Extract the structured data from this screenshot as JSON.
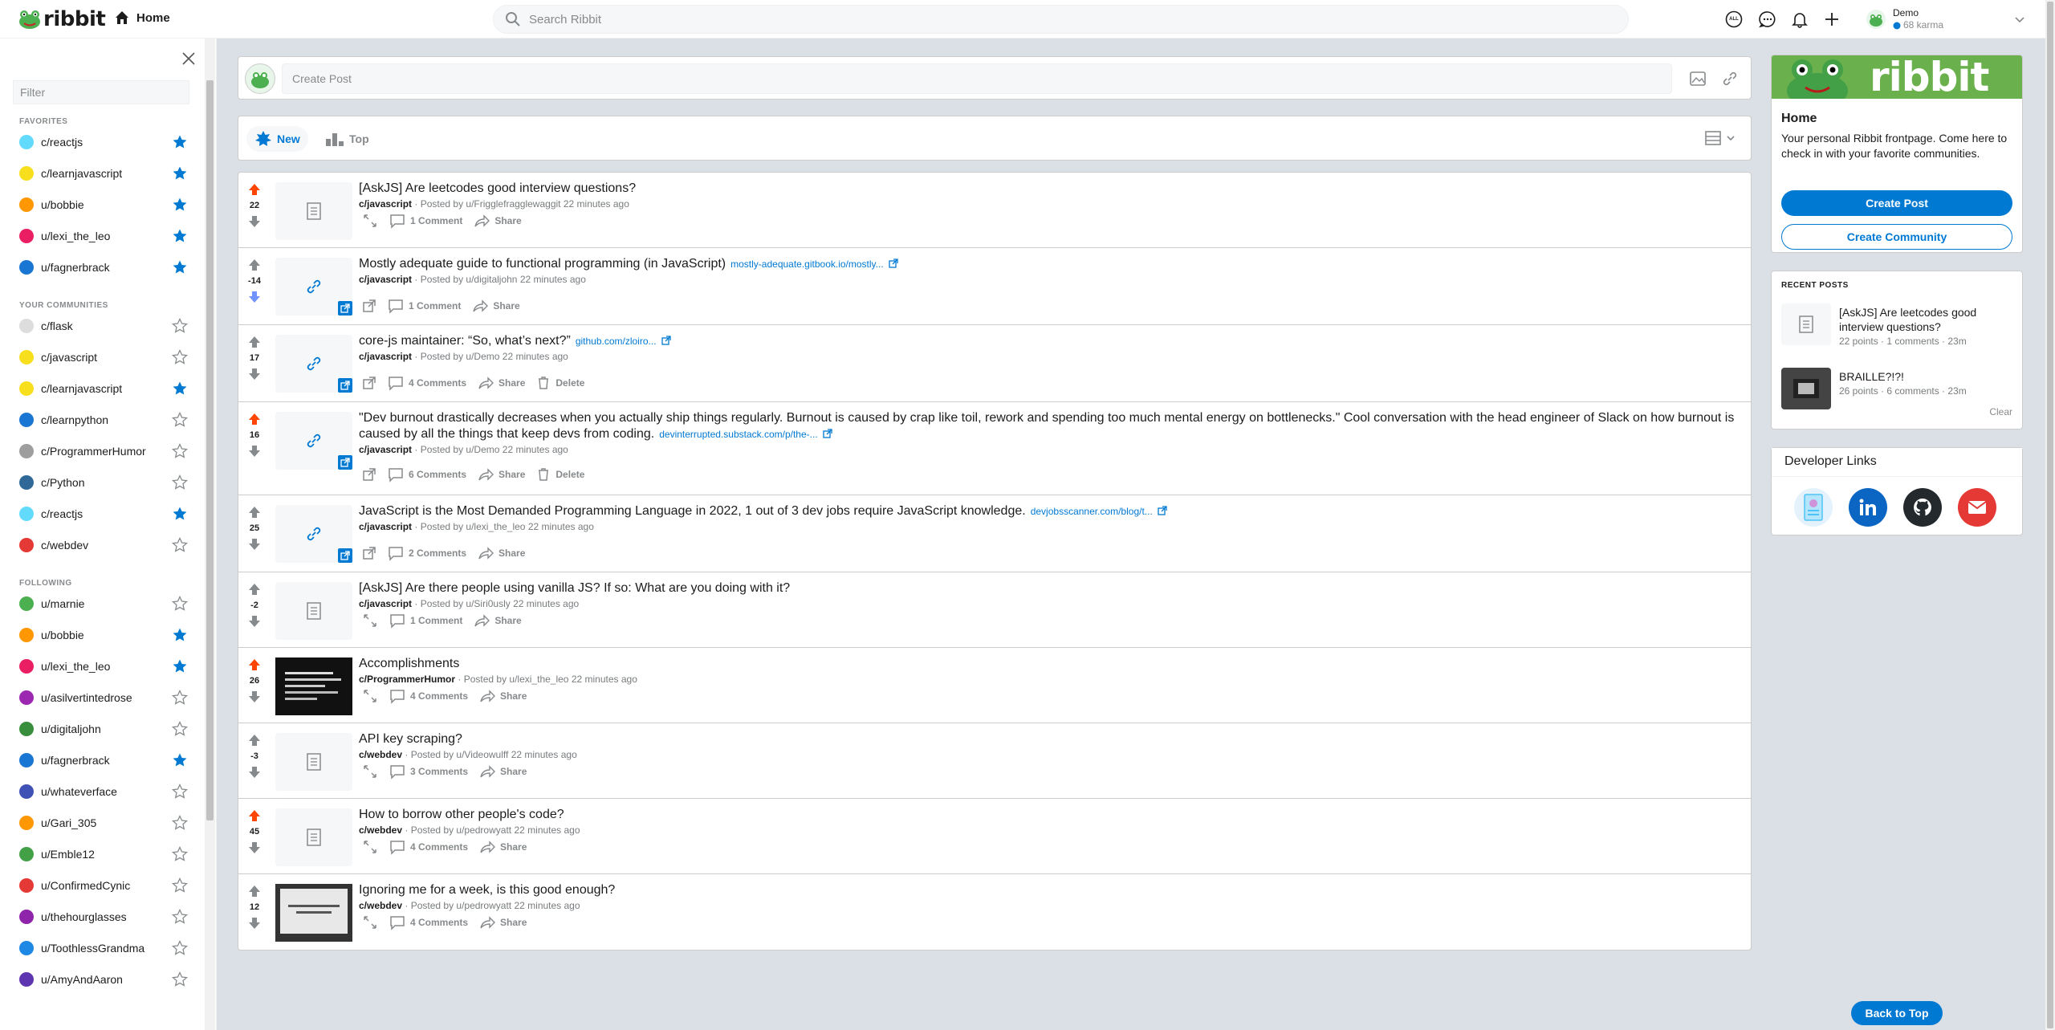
{
  "nav": {
    "logo_text": "ribbit",
    "home_label": "Home",
    "search_placeholder": "Search Ribbit",
    "user_name": "Demo",
    "user_karma": "68 karma",
    "all_badge": "ALL"
  },
  "sidebar": {
    "filter_placeholder": "Filter",
    "sections": [
      {
        "title": "Favorites",
        "items": [
          {
            "label": "c/reactjs",
            "fav": true,
            "color": "#61dafb"
          },
          {
            "label": "c/learnjavascript",
            "fav": true,
            "color": "#f7df1e"
          },
          {
            "label": "u/bobbie",
            "fav": true,
            "color": "#ff9800"
          },
          {
            "label": "u/lexi_the_leo",
            "fav": true,
            "color": "#e91e63"
          },
          {
            "label": "u/fagnerbrack",
            "fav": true,
            "color": "#1976d2"
          }
        ]
      },
      {
        "title": "Your Communities",
        "items": [
          {
            "label": "c/flask",
            "fav": false,
            "color": "#dddddd"
          },
          {
            "label": "c/javascript",
            "fav": false,
            "color": "#f7df1e"
          },
          {
            "label": "c/learnjavascript",
            "fav": true,
            "color": "#f7df1e"
          },
          {
            "label": "c/learnpython",
            "fav": false,
            "color": "#1976d2"
          },
          {
            "label": "c/ProgrammerHumor",
            "fav": false,
            "color": "#9e9e9e"
          },
          {
            "label": "c/Python",
            "fav": false,
            "color": "#306998"
          },
          {
            "label": "c/reactjs",
            "fav": true,
            "color": "#61dafb"
          },
          {
            "label": "c/webdev",
            "fav": false,
            "color": "#e53935"
          }
        ]
      },
      {
        "title": "Following",
        "items": [
          {
            "label": "u/marnie",
            "fav": false,
            "color": "#4caf50"
          },
          {
            "label": "u/bobbie",
            "fav": true,
            "color": "#ff9800"
          },
          {
            "label": "u/lexi_the_leo",
            "fav": true,
            "color": "#e91e63"
          },
          {
            "label": "u/asilvertintedrose",
            "fav": false,
            "color": "#9c27b0"
          },
          {
            "label": "u/digitaljohn",
            "fav": false,
            "color": "#388e3c"
          },
          {
            "label": "u/fagnerbrack",
            "fav": true,
            "color": "#1976d2"
          },
          {
            "label": "u/whateverface",
            "fav": false,
            "color": "#3f51b5"
          },
          {
            "label": "u/Gari_305",
            "fav": false,
            "color": "#ff9800"
          },
          {
            "label": "u/Emble12",
            "fav": false,
            "color": "#43a047"
          },
          {
            "label": "u/ConfirmedCynic",
            "fav": false,
            "color": "#e53935"
          },
          {
            "label": "u/thehourglasses",
            "fav": false,
            "color": "#8e24aa"
          },
          {
            "label": "u/ToothlessGrandma",
            "fav": false,
            "color": "#1e88e5"
          },
          {
            "label": "u/AmyAndAaron",
            "fav": false,
            "color": "#5e35b1"
          }
        ]
      }
    ]
  },
  "create_post": {
    "placeholder": "Create Post"
  },
  "sort": {
    "new_label": "New",
    "top_label": "Top"
  },
  "posts": [
    {
      "title": "[AskJS] Are leetcodes good interview questions?",
      "domain": "",
      "community": "c/javascript",
      "posted_by": "Posted by u/Frigglefragglewaggit",
      "time": "22 minutes ago",
      "score": "22",
      "vote": "up",
      "thumb": "text",
      "comments": "1 Comment",
      "share": "Share",
      "delete": "",
      "height": 94
    },
    {
      "title": "Mostly adequate guide to functional programming (in JavaScript)",
      "domain": "mostly-adequate.gitbook.io/mostly...",
      "community": "c/javascript",
      "posted_by": "Posted by u/digitaljohn",
      "time": "22 minutes ago",
      "score": "-14",
      "vote": "down",
      "thumb": "link",
      "comments": "1 Comment",
      "share": "Share",
      "delete": "",
      "height": 96
    },
    {
      "title": "core-js maintainer: “So, what’s next?”",
      "domain": "github.com/zloiro...",
      "community": "c/javascript",
      "posted_by": "Posted by u/Demo",
      "time": "22 minutes ago",
      "score": "17",
      "vote": "none",
      "thumb": "link",
      "comments": "4 Comments",
      "share": "Share",
      "delete": "Delete",
      "height": 96
    },
    {
      "title": "\"Dev burnout drastically decreases when you actually ship things regularly. Burnout is caused by crap like toil, rework and spending too much mental energy on bottlenecks.\" Cool conversation with the head engineer of Slack on how burnout is caused by all the things that keep devs from coding.",
      "domain": "devinterrupted.substack.com/p/the-...",
      "community": "c/javascript",
      "posted_by": "Posted by u/Demo",
      "time": "22 minutes ago",
      "score": "16",
      "vote": "up",
      "thumb": "link",
      "comments": "6 Comments",
      "share": "Share",
      "delete": "Delete",
      "height": 116
    },
    {
      "title": "JavaScript is the Most Demanded Programming Language in 2022, 1 out of 3 dev jobs require JavaScript knowledge.",
      "domain": "devjobsscanner.com/blog/t...",
      "community": "c/javascript",
      "posted_by": "Posted by u/lexi_the_leo",
      "time": "22 minutes ago",
      "score": "25",
      "vote": "none",
      "thumb": "link",
      "comments": "2 Comments",
      "share": "Share",
      "delete": "",
      "height": 96
    },
    {
      "title": "[AskJS] Are there people using vanilla JS? If so: What are you doing with it?",
      "domain": "",
      "community": "c/javascript",
      "posted_by": "Posted by u/Siri0usly",
      "time": "22 minutes ago",
      "score": "-2",
      "vote": "none",
      "thumb": "text",
      "comments": "1 Comment",
      "share": "Share",
      "delete": "",
      "height": 94
    },
    {
      "title": "Accomplishments",
      "domain": "",
      "community": "c/ProgrammerHumor",
      "posted_by": "Posted by u/lexi_the_leo",
      "time": "22 minutes ago",
      "score": "26",
      "vote": "up",
      "thumb": "image-dark",
      "comments": "4 Comments",
      "share": "Share",
      "delete": "",
      "height": 94
    },
    {
      "title": "API key scraping?",
      "domain": "",
      "community": "c/webdev",
      "posted_by": "Posted by u/Videowulff",
      "time": "22 minutes ago",
      "score": "-3",
      "vote": "none",
      "thumb": "text",
      "comments": "3 Comments",
      "share": "Share",
      "delete": "",
      "height": 94
    },
    {
      "title": "How to borrow other people's code?",
      "domain": "",
      "community": "c/webdev",
      "posted_by": "Posted by u/pedrowyatt",
      "time": "22 minutes ago",
      "score": "45",
      "vote": "up",
      "thumb": "text",
      "comments": "4 Comments",
      "share": "Share",
      "delete": "",
      "height": 94
    },
    {
      "title": "Ignoring me for a week, is this good enough?",
      "domain": "",
      "community": "c/webdev",
      "posted_by": "Posted by u/pedrowyatt",
      "time": "22 minutes ago",
      "score": "12",
      "vote": "none",
      "thumb": "image-light",
      "comments": "4 Comments",
      "share": "Share",
      "delete": "",
      "height": 94
    }
  ],
  "home_card": {
    "banner_text": "ribbit",
    "title": "Home",
    "description": "Your personal Ribbit frontpage. Come here to check in with your favorite communities.",
    "create_post": "Create Post",
    "create_community": "Create Community"
  },
  "recent_posts": {
    "title": "Recent Posts",
    "items": [
      {
        "title": "[AskJS] Are leetcodes good interview questions?",
        "meta": "22 points · 1 comments · 23m",
        "thumb": "text"
      },
      {
        "title": "BRAILLE?!?!",
        "meta": "26 points · 6 comments · 23m",
        "thumb": "image"
      }
    ],
    "clear": "Clear"
  },
  "developer_links": {
    "title": "Developer Links",
    "links": [
      {
        "name": "portfolio-icon",
        "color": "#e3f2fd"
      },
      {
        "name": "linkedin-icon",
        "color": "#0a66c2"
      },
      {
        "name": "github-icon",
        "color": "#24292e"
      },
      {
        "name": "email-icon",
        "color": "#e53935"
      }
    ]
  },
  "back_to_top": "Back to Top",
  "colors": {
    "accent": "#0079d3",
    "upvote": "#ff4500",
    "downvote": "#7193ff"
  }
}
